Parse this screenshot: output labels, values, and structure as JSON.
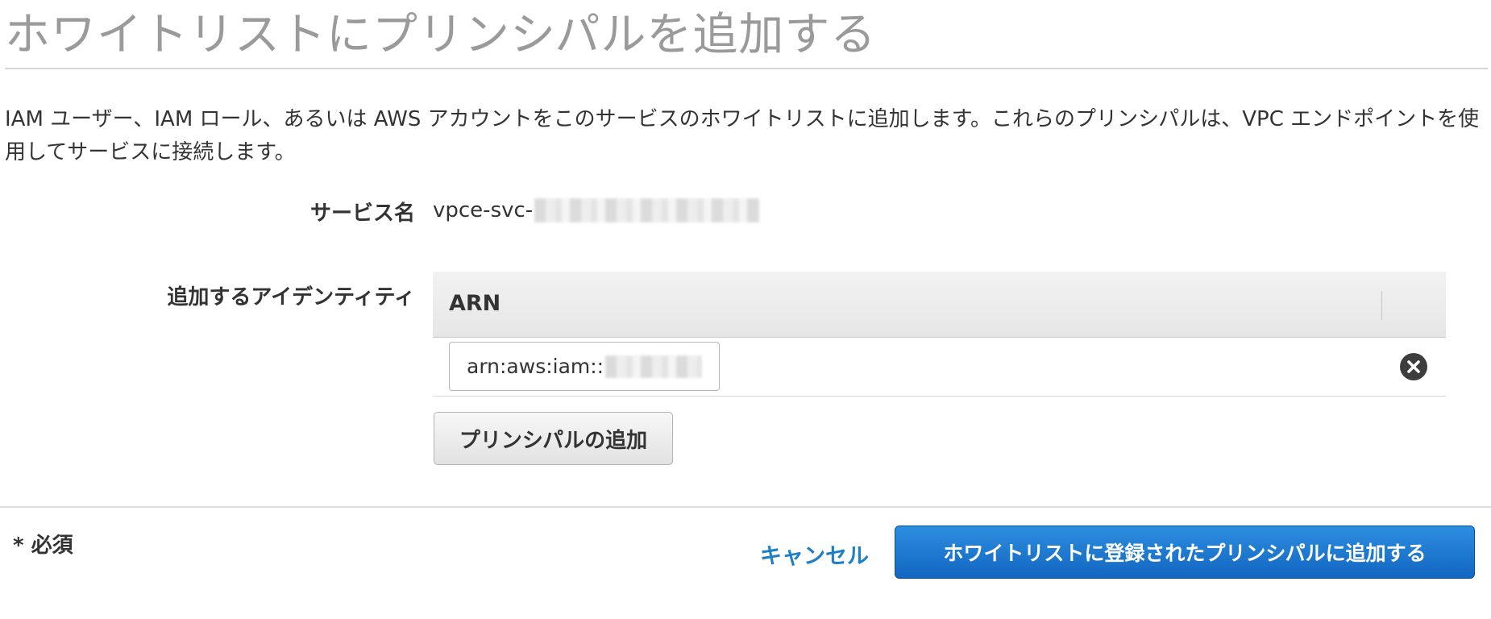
{
  "page": {
    "title": "ホワイトリストにプリンシパルを追加する",
    "description": "IAM ユーザー、IAM ロール、あるいは AWS アカウントをこのサービスのホワイトリストに追加します。これらのプリンシパルは、VPC エンドポイントを使用してサービスに接続します。"
  },
  "form": {
    "service_name_label": "サービス名",
    "service_name_value": "vpce-svc-",
    "identities_label": "追加するアイデンティティ",
    "table": {
      "column_header": "ARN",
      "rows": [
        {
          "arn_value": "arn:aws:iam::"
        }
      ]
    },
    "add_principal_label": "プリンシパルの追加"
  },
  "footer": {
    "required_note": "* 必須",
    "cancel_label": "キャンセル",
    "submit_label": "ホワイトリストに登録されたプリンシパルに追加する"
  },
  "icons": {
    "remove": "close-circle-icon"
  },
  "colors": {
    "primary_button": "#1a73c9",
    "link": "#1e7ec8",
    "title": "#9a9a9a",
    "remove_icon": "#3d3d3d"
  }
}
